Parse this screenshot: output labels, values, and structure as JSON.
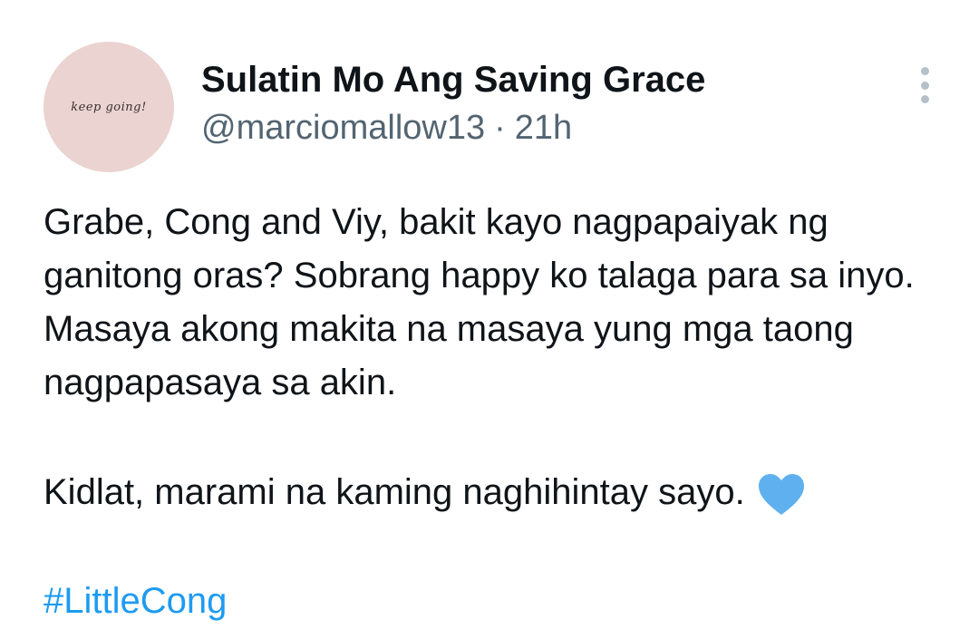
{
  "author": {
    "avatar_text": "keep going!",
    "display_name": "Sulatin Mo Ang Saving Grace",
    "handle": "@marciomallow13",
    "separator": "·",
    "timestamp": "21h"
  },
  "tweet": {
    "paragraph1": "Grabe, Cong and Viy, bakit kayo nagpapaiyak ng ganitong oras? Sobrang happy ko talaga para sa inyo. Masaya akong makita na masaya yung mga taong nagpapasaya sa akin.",
    "paragraph2": "Kidlat, marami na kaming naghihintay sayo.",
    "emoji_icon": "blue-heart-icon",
    "hashtag": "#LittleCong"
  },
  "colors": {
    "text_primary": "#0f1419",
    "text_secondary": "#536471",
    "link": "#1d9bf0",
    "heart": "#5eb1ee",
    "avatar_bg": "#ead3d0"
  }
}
